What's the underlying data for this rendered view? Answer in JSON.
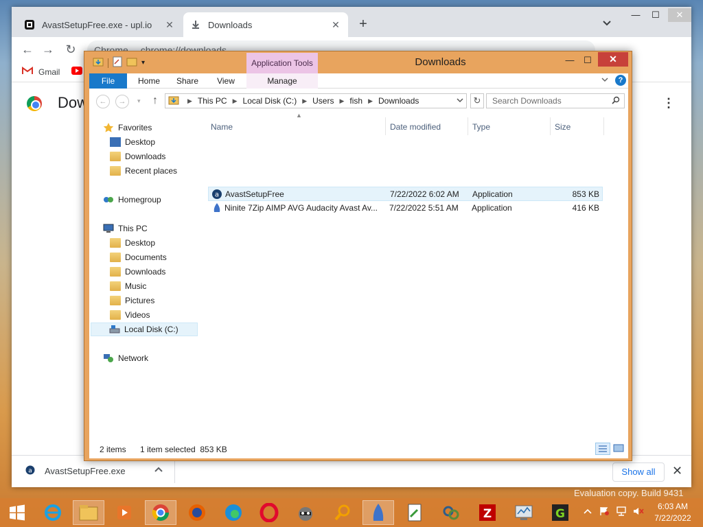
{
  "chrome": {
    "tabs": [
      {
        "title": "AvastSetupFree.exe - upl.io",
        "active": false
      },
      {
        "title": "Downloads",
        "active": true
      }
    ],
    "new_tab": "+",
    "address": {
      "brand": "Chrome",
      "url": "chrome://downloads"
    },
    "bookmarks": [
      {
        "label": "Gmail"
      }
    ],
    "page_title": "Downloads",
    "page_title_visible": "Dow",
    "shelf": {
      "filename": "AvastSetupFree.exe",
      "show_all": "Show all"
    }
  },
  "explorer": {
    "title": "Downloads",
    "contextual_tab": "Application Tools",
    "ribbon_tabs": [
      "File",
      "Home",
      "Share",
      "View",
      "Manage"
    ],
    "breadcrumb": [
      "This PC",
      "Local Disk (C:)",
      "Users",
      "fish",
      "Downloads"
    ],
    "search_placeholder": "Search Downloads",
    "nav": {
      "favorites": {
        "label": "Favorites",
        "items": [
          "Desktop",
          "Downloads",
          "Recent places"
        ]
      },
      "homegroup": "Homegroup",
      "thispc": {
        "label": "This PC",
        "items": [
          "Desktop",
          "Documents",
          "Downloads",
          "Music",
          "Pictures",
          "Videos",
          "Local Disk (C:)"
        ]
      },
      "network": "Network"
    },
    "columns": [
      "Name",
      "Date modified",
      "Type",
      "Size"
    ],
    "files": [
      {
        "name": "AvastSetupFree",
        "date": "7/22/2022 6:02 AM",
        "type": "Application",
        "size": "853 KB",
        "selected": true
      },
      {
        "name": "Ninite 7Zip AIMP AVG Audacity Avast Av...",
        "date": "7/22/2022 5:51 AM",
        "type": "Application",
        "size": "416 KB",
        "selected": false
      }
    ],
    "status": {
      "count": "2 items",
      "selected": "1 item selected  853 KB"
    }
  },
  "taskbar": {
    "clock_time": "6:03 AM",
    "clock_date": "7/22/2022",
    "watermark": "Evaluation copy. Build 9431"
  },
  "colors": {
    "explorer_frame": "#e8a45e",
    "file_tab": "#1979ca",
    "close_red": "#c7413a",
    "app_tools": "#ecc4e6",
    "link_blue": "#1a73e8"
  }
}
